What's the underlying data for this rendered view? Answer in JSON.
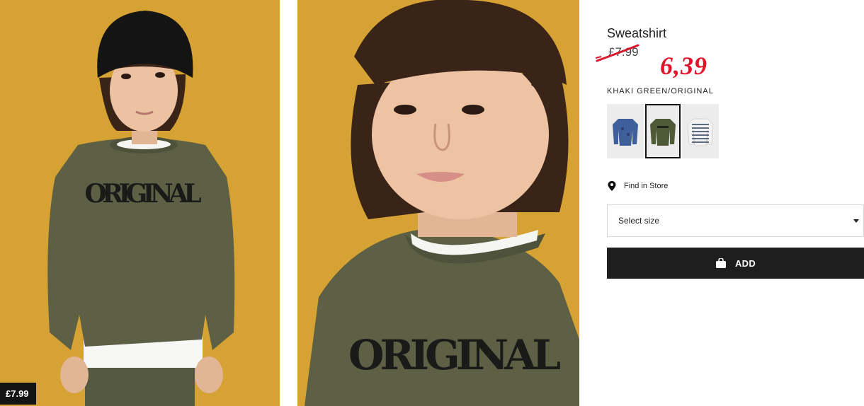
{
  "product": {
    "title": "Sweatshirt",
    "old_price": "£7.99",
    "new_price": "6,39",
    "color_name": "KHAKI GREEN/ORIGINAL"
  },
  "photos": {
    "left_price_tag": "£7.99",
    "print_text": "ORIGINAL"
  },
  "swatches": [
    {
      "color": "blue",
      "selected": false
    },
    {
      "color": "khaki-green",
      "selected": true
    },
    {
      "color": "white-striped",
      "selected": false
    }
  ],
  "actions": {
    "find_in_store": "Find in Store",
    "select_size": "Select size",
    "add_label": "ADD"
  },
  "colors": {
    "background": "#d5a233",
    "sweatshirt": "#5d6045",
    "accent_red": "#e0152b",
    "button": "#1e1e1e"
  },
  "icons": {
    "pin": "map-pin-icon",
    "caret": "caret-down-icon",
    "bag": "shopping-bag-icon"
  }
}
